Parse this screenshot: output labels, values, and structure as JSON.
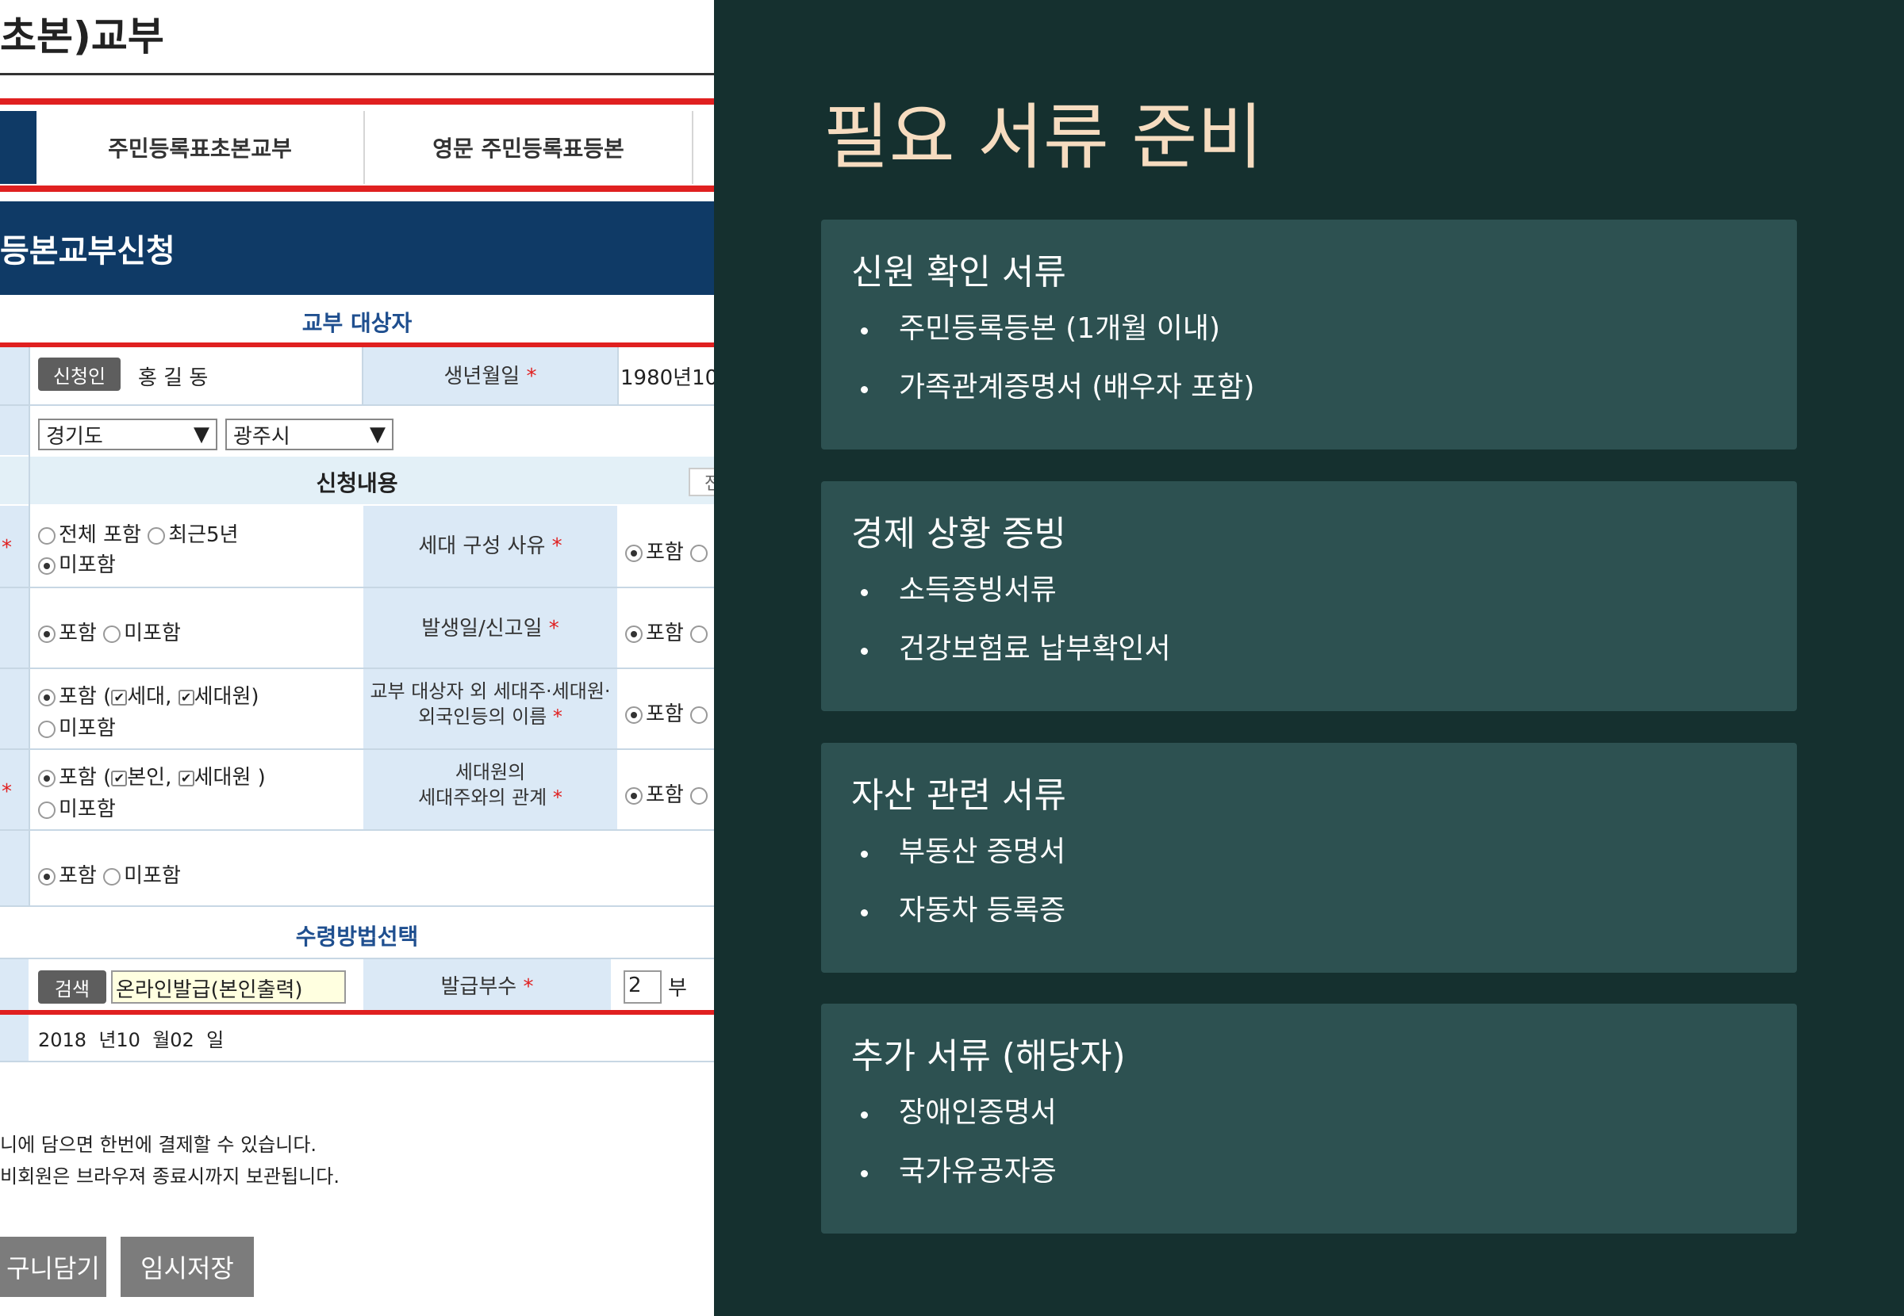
{
  "form": {
    "page_title": "초본)교부",
    "tabs": [
      "주민등록표초본교부",
      "영문 주민등록표등본"
    ],
    "form_header": "등본교부신청",
    "section_recipient": "교부 대상자",
    "applicant_badge": "신청인",
    "applicant_name": "홍 길 동",
    "birth_label": "생년월일",
    "birth_value": "1980년10",
    "province_select": "경기도",
    "city_select": "광주시",
    "section_request": "신청내용",
    "request_side_button": "전",
    "required_mark": "*",
    "row1_opt1": "전체 포함",
    "row1_opt2": "최근5년",
    "row1_opt3": "미포함",
    "row1_label": "세대 구성 사유",
    "row2_opt1": "포함",
    "row2_opt2": "미포함",
    "row2_label": "발생일/신고일",
    "row3_opt1_prefix": "포함 (",
    "row3_check1": "세대,",
    "row3_check2": "세대원)",
    "row3_opt2": "미포함",
    "row3_label_line1": "교부 대상자 외 세대주·세대원·",
    "row3_label_line2": "외국인등의 이름",
    "row4_opt1_prefix": "포함 (",
    "row4_check1": "본인,",
    "row4_check2": "세대원 )",
    "row4_opt2": "미포함",
    "row4_label_line1": "세대원의",
    "row4_label_line2": "세대주와의 관계",
    "row5_opt1": "포함",
    "row5_opt2": "미포함",
    "right_col_option": "포함",
    "section_receive": "수령방법선택",
    "search_button": "검색",
    "receive_value": "온라인발급(본인출력)",
    "copies_label": "발급부수",
    "copies_value": "2",
    "copies_unit": "부",
    "date_text": "2018  년10  월02  일",
    "note_line1": "니에 담으면 한번에 결제할 수 있습니다.",
    "note_line2": "비회원은 브라우져 종료시까지 보관됩니다.",
    "cart_button": "구니담기",
    "temp_save_button": "임시저장"
  },
  "slide": {
    "title": "필요 서류 준비",
    "cards": [
      {
        "title": "신원 확인 서류",
        "items": [
          "주민등록등본 (1개월 이내)",
          "가족관계증명서 (배우자 포함)"
        ]
      },
      {
        "title": "경제 상황 증빙",
        "items": [
          "소득증빙서류",
          "건강보험료 납부확인서"
        ]
      },
      {
        "title": "자산 관련 서류",
        "items": [
          "부동산 증명서",
          "자동차 등록증"
        ]
      },
      {
        "title": "추가 서류 (해당자)",
        "items": [
          "장애인증명서",
          "국가유공자증"
        ]
      }
    ],
    "colors": {
      "background": "#15302f",
      "card": "#2d5151",
      "title": "#f6dcc0",
      "text": "#ffffff"
    }
  }
}
